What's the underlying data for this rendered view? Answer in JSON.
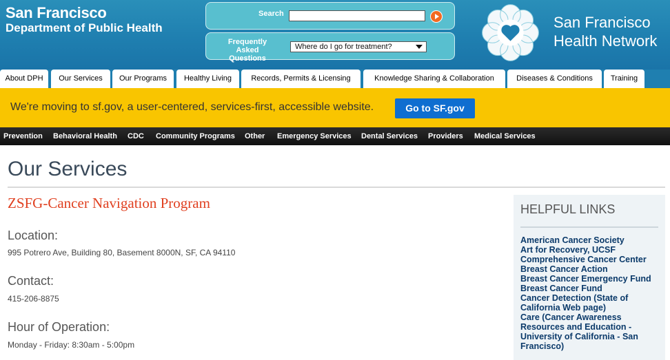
{
  "header": {
    "logo_line1": "San Francisco",
    "logo_line2": "Department of Public Health",
    "search_label": "Search",
    "search_value": "",
    "faq_label": "Frequently Asked Questions",
    "faq_selected": "Where do I go for treatment?",
    "network_title_line1": "San Francisco",
    "network_title_line2": "Health Network"
  },
  "tabs": [
    {
      "label": "About DPH"
    },
    {
      "label": "Our Services"
    },
    {
      "label": "Our Programs"
    },
    {
      "label": "Healthy Living"
    },
    {
      "label": "Records, Permits & Licensing"
    },
    {
      "label": "Knowledge Sharing & Collaboration"
    },
    {
      "label": "Diseases & Conditions"
    },
    {
      "label": "Training"
    }
  ],
  "banner": {
    "message": "We're moving to sf.gov, a user-centered, services-first, accessible website.",
    "button": "Go to SF.gov"
  },
  "subnav": [
    {
      "label": "Prevention"
    },
    {
      "label": "Behavioral Health"
    },
    {
      "label": "CDC"
    },
    {
      "label": "Community Programs"
    },
    {
      "label": "Other"
    },
    {
      "label": "Emergency Services"
    },
    {
      "label": "Dental Services"
    },
    {
      "label": "Providers"
    },
    {
      "label": "Medical Services"
    }
  ],
  "main": {
    "page_title": "Our Services",
    "program_title": "ZSFG-Cancer Navigation Program",
    "location_label": "Location:",
    "location_value": "995 Potrero Ave, Building 80, Basement 8000N, SF, CA 94110",
    "contact_label": "Contact:",
    "contact_value": "415-206-8875",
    "hours_label": "Hour of Operation:",
    "hours_value": "Monday - Friday: 8:30am - 5:00pm"
  },
  "sidebar": {
    "heading": "HELPFUL LINKS",
    "links": [
      {
        "label": "American Cancer Society"
      },
      {
        "label": "Art for Recovery, UCSF Comprehensive Cancer Center"
      },
      {
        "label": "Breast Cancer Action"
      },
      {
        "label": "Breast Cancer Emergency Fund"
      },
      {
        "label": "Breast Cancer Fund"
      },
      {
        "label": "Cancer Detection (State of California Web page)"
      },
      {
        "label": "Care (Cancer Awareness Resources and Education - University of California - San Francisco)"
      }
    ]
  },
  "colors": {
    "header_blue": "#1f7fb0",
    "banner_yellow": "#f9c500",
    "button_blue": "#0f6ed0",
    "program_title": "#e04020",
    "link_navy": "#0b3a6a"
  },
  "icons": [
    "search-go-icon",
    "dropdown-caret-icon",
    "heart-flower-logo-icon"
  ]
}
